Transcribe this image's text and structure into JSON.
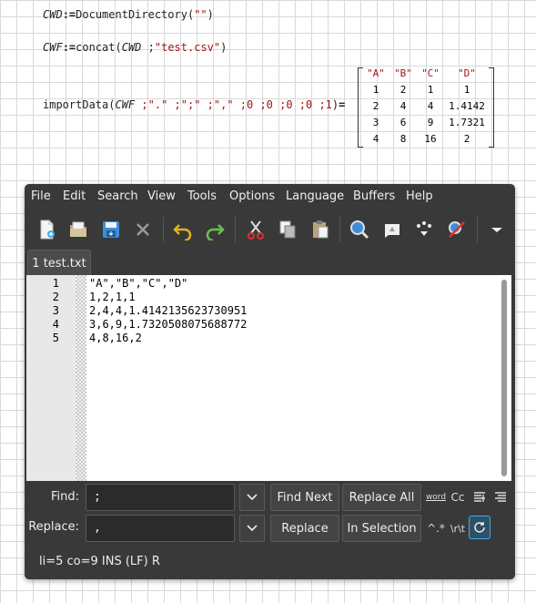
{
  "worksheet": {
    "line1": {
      "var": "CWD",
      "assign": ":=",
      "func": "DocumentDirectory",
      "open": "(",
      "arg": "\"\"",
      "close": ")"
    },
    "line2": {
      "var": "CWF",
      "assign": ":=",
      "func": "concat",
      "open": "(",
      "arg1": "CWD",
      "sep": " ;",
      "arg2": "\"test.csv\"",
      "close": ")"
    },
    "line3": {
      "func": "importData",
      "open": "(",
      "arg1": "CWF",
      "args": " ;\".\" ;\";\" ;\",\" ;0 ;0 ;0 ;0 ;1",
      "close": ")",
      "eq": "="
    },
    "matrix": {
      "header": [
        "\"A\"",
        "\"B\"",
        "\"C\"",
        "\"D\""
      ],
      "rows": [
        [
          "1",
          "2",
          "1",
          "1"
        ],
        [
          "2",
          "4",
          "4",
          "1.4142"
        ],
        [
          "3",
          "6",
          "9",
          "1.7321"
        ],
        [
          "4",
          "8",
          "16",
          "2"
        ]
      ]
    }
  },
  "editor": {
    "menu": [
      "File",
      "Edit",
      "Search",
      "View",
      "Tools",
      "Options",
      "Language",
      "Buffers",
      "Help"
    ],
    "toolbar_icons": [
      "new-file-icon",
      "open-file-icon",
      "save-file-icon",
      "close-icon",
      "undo-icon",
      "redo-icon",
      "cut-icon",
      "copy-icon",
      "paste-icon",
      "find-icon",
      "build-icon",
      "macro-icon",
      "tools-icon",
      "overflow-chevron-icon"
    ],
    "tab_label": "1 test.txt",
    "line_numbers": [
      "1",
      "2",
      "3",
      "4",
      "5"
    ],
    "lines": [
      "\"A\",\"B\",\"C\",\"D\"",
      "1,2,1,1",
      "2,4,4,1.4142135623730951",
      "3,6,9,1.7320508075688772",
      "4,8,16,2"
    ],
    "find_label": "Find:",
    "find_value": ";",
    "replace_label": "Replace:",
    "replace_value": ",",
    "find_next": "Find Next",
    "replace_all": "Replace All",
    "replace": "Replace",
    "in_selection": "In Selection",
    "opt_word": "word",
    "opt_case": "Cc",
    "opt_regex": "^.*",
    "opt_escape": "\\r\\t",
    "status": "li=5 co=9 INS (LF) R",
    "colors": {
      "accent": "#3daee9",
      "background": "#393939"
    }
  }
}
